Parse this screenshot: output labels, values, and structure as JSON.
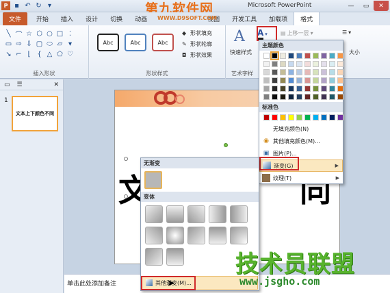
{
  "window": {
    "title": "Microsoft PowerPoint",
    "watermark_top": "第九软件网",
    "watermark_url": "WWW.D9SOFT.COM"
  },
  "tabs": [
    "文件",
    "开始",
    "插入",
    "设计",
    "切换",
    "动画",
    "视图",
    "开发工具",
    "加载项",
    "格式"
  ],
  "ribbon": {
    "insert_shapes_label": "插入形状",
    "shape_styles_label": "形状样式",
    "wordart_label": "艺术字样",
    "style_box_text": "Abc",
    "shape_fill": "形状填充",
    "shape_outline": "形状轮廓",
    "shape_effects": "形状效果",
    "quick_styles": "快速样式",
    "bring_forward": "上移一层",
    "size_label": "大小"
  },
  "left_panel": {
    "slide_number": "1",
    "thumb_text": "文本上下颜色不同"
  },
  "slide": {
    "char_left": "文",
    "char_right": "同"
  },
  "notes": {
    "placeholder": "单击此处添加备注"
  },
  "color_menu": {
    "theme_colors_label": "主题颜色",
    "standard_colors_label": "标准色",
    "theme_colors": [
      [
        "#ffffff",
        "#000000",
        "#eeece1",
        "#1f497d",
        "#4f81bd",
        "#c0504d",
        "#9bbb59",
        "#8064a2",
        "#4bacc6",
        "#f79646"
      ],
      [
        "#f2f2f2",
        "#7f7f7f",
        "#ddd9c3",
        "#c6d9f0",
        "#dbe5f1",
        "#f2dcdb",
        "#ebf1dd",
        "#e5e0ec",
        "#dbeef3",
        "#fdeada"
      ],
      [
        "#d8d8d8",
        "#595959",
        "#c4bd97",
        "#8db3e2",
        "#b8cce4",
        "#e5b9b7",
        "#d7e3bc",
        "#ccc1d9",
        "#b7dde8",
        "#fbd5b5"
      ],
      [
        "#bfbfbf",
        "#3f3f3f",
        "#938953",
        "#548dd4",
        "#95b3d7",
        "#d99694",
        "#c3d69b",
        "#b2a2c7",
        "#92cddc",
        "#fac08f"
      ],
      [
        "#a5a5a5",
        "#262626",
        "#494429",
        "#17365d",
        "#366092",
        "#953734",
        "#76923c",
        "#5f497a",
        "#31859b",
        "#e36c09"
      ],
      [
        "#7f7f7f",
        "#0c0c0c",
        "#1d1b10",
        "#0f243e",
        "#244061",
        "#632423",
        "#4f6128",
        "#3f3151",
        "#205867",
        "#974806"
      ]
    ],
    "standard_colors": [
      "#c00000",
      "#ff0000",
      "#ffc000",
      "#ffff00",
      "#92d050",
      "#00b050",
      "#00b0f0",
      "#0070c0",
      "#002060",
      "#7030a0"
    ],
    "items": [
      {
        "label": "无填充颜色(N)"
      },
      {
        "label": "其他填充颜色(M)..."
      },
      {
        "label": "图片(P)..."
      },
      {
        "label": "渐变(G)"
      },
      {
        "label": "纹理(T)"
      }
    ]
  },
  "gradient_menu": {
    "no_gradient_label": "无渐变",
    "variants_label": "变体",
    "more_gradients": "其他渐变(M)..."
  },
  "watermark_bottom": {
    "brand": "技术员联盟",
    "url": "www.jsgho.com"
  }
}
